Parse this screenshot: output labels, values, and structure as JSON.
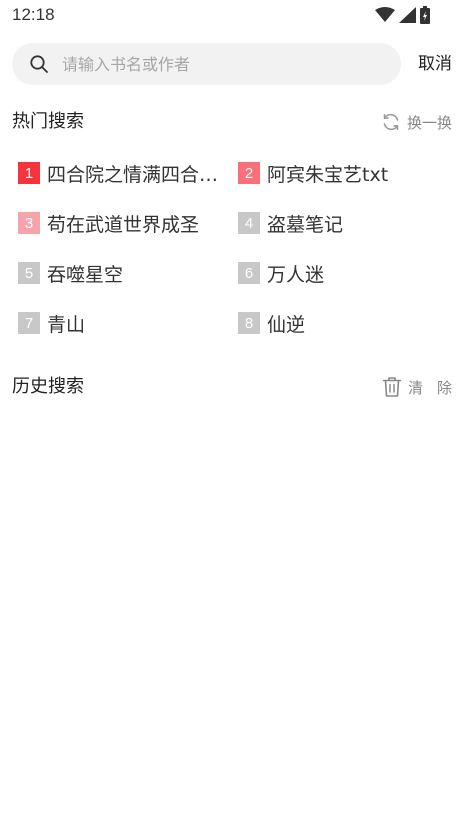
{
  "status": {
    "time": "12:18"
  },
  "search": {
    "placeholder": "请输入书名或作者",
    "value": "",
    "cancel_label": "取消"
  },
  "hot": {
    "title": "热门搜索",
    "refresh_label": "换一换",
    "items": [
      {
        "rank": "1",
        "name": "四合院之情满四合…",
        "color": "#f5343d"
      },
      {
        "rank": "2",
        "name": "阿宾朱宝艺txt",
        "color": "#f7707a"
      },
      {
        "rank": "3",
        "name": "苟在武道世界成圣",
        "color": "#f6a4aa"
      },
      {
        "rank": "4",
        "name": "盗墓笔记",
        "color": "#c8c8c8"
      },
      {
        "rank": "5",
        "name": "吞噬星空",
        "color": "#c8c8c8"
      },
      {
        "rank": "6",
        "name": "万人迷",
        "color": "#c8c8c8"
      },
      {
        "rank": "7",
        "name": "青山",
        "color": "#c8c8c8"
      },
      {
        "rank": "8",
        "name": "仙逆",
        "color": "#c8c8c8"
      }
    ]
  },
  "history": {
    "title": "历史搜索",
    "clear_label": "清除"
  }
}
